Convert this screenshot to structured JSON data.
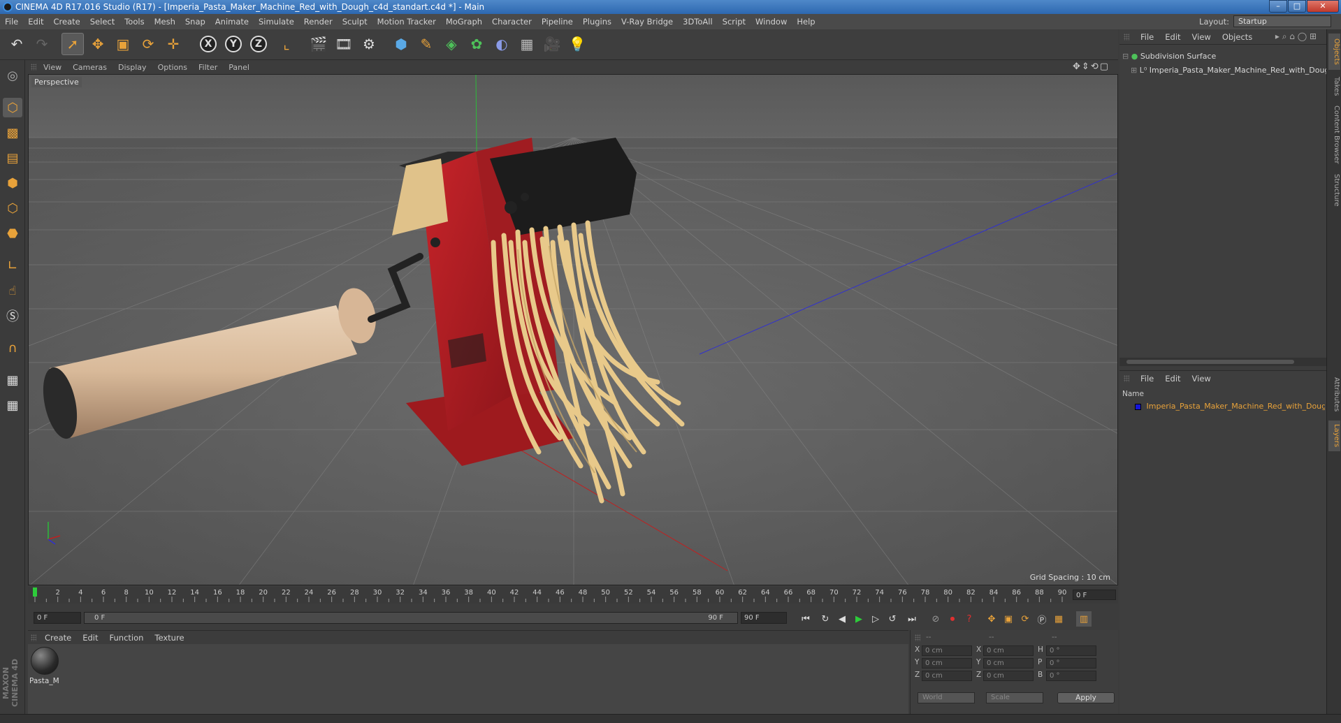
{
  "window": {
    "title": "CINEMA 4D R17.016 Studio (R17) - [Imperia_Pasta_Maker_Machine_Red_with_Dough_c4d_standart.c4d *] - Main",
    "minimize": "–",
    "maximize": "□",
    "close": "✕"
  },
  "menubar": {
    "items": [
      "File",
      "Edit",
      "Create",
      "Select",
      "Tools",
      "Mesh",
      "Snap",
      "Animate",
      "Simulate",
      "Render",
      "Sculpt",
      "Motion Tracker",
      "MoGraph",
      "Character",
      "Pipeline",
      "Plugins",
      "V-Ray Bridge",
      "3DToAll",
      "Script",
      "Window",
      "Help"
    ],
    "layout_label": "Layout:",
    "layout_value": "Startup"
  },
  "toolbar": {
    "axis_x": "X",
    "axis_y": "Y",
    "axis_z": "Z"
  },
  "viewport": {
    "menu": [
      "View",
      "Cameras",
      "Display",
      "Options",
      "Filter",
      "Panel"
    ],
    "camera_label": "Perspective",
    "grid_spacing": "Grid Spacing : 10 cm",
    "nav_icons": "✥⇕⟲▢"
  },
  "timeline": {
    "ticks": [
      "0",
      "2",
      "4",
      "6",
      "8",
      "10",
      "12",
      "14",
      "16",
      "18",
      "20",
      "22",
      "24",
      "26",
      "28",
      "30",
      "32",
      "34",
      "36",
      "38",
      "40",
      "42",
      "44",
      "46",
      "48",
      "50",
      "52",
      "54",
      "56",
      "58",
      "60",
      "62",
      "64",
      "66",
      "68",
      "70",
      "72",
      "74",
      "76",
      "78",
      "80",
      "82",
      "84",
      "86",
      "88",
      "90"
    ],
    "current_frame_right": "0 F",
    "start_frame": "0 F",
    "range_start": "0 F",
    "range_end": "90 F",
    "end_frame": "90 F"
  },
  "material_manager": {
    "menu": [
      "Create",
      "Edit",
      "Function",
      "Texture"
    ],
    "materials": [
      {
        "name": "Pasta_M"
      }
    ]
  },
  "coordinates": {
    "header": [
      "--",
      "--",
      "--"
    ],
    "rows": [
      {
        "a": "X",
        "a_val": "0 cm",
        "b": "X",
        "b_val": "0 cm",
        "c": "H",
        "c_val": "0 °"
      },
      {
        "a": "Y",
        "a_val": "0 cm",
        "b": "Y",
        "b_val": "0 cm",
        "c": "P",
        "c_val": "0 °"
      },
      {
        "a": "Z",
        "a_val": "0 cm",
        "b": "Z",
        "b_val": "0 cm",
        "c": "B",
        "c_val": "0 °"
      }
    ],
    "space": "World",
    "mode": "Scale",
    "apply": "Apply"
  },
  "object_manager": {
    "menu": [
      "File",
      "Edit",
      "View",
      "Objects"
    ],
    "objects": [
      {
        "name": "Subdivision Surface"
      },
      {
        "name": "Imperia_Pasta_Maker_Machine_Red_with_Dough"
      }
    ]
  },
  "layer_manager": {
    "menu": [
      "File",
      "Edit",
      "View"
    ],
    "column_name": "Name",
    "layers": [
      {
        "name": "Imperia_Pasta_Maker_Machine_Red_with_Dough",
        "color": "#1515d8"
      }
    ]
  },
  "right_tabs": [
    "Objects",
    "Takes",
    "Content Browser",
    "Structure",
    "Attributes",
    "Layers"
  ],
  "branding": "MAXON CINEMA 4D",
  "colors": {
    "accent": "#e8a23a",
    "machine_red": "#b51f24",
    "pasta": "#e8c98a"
  }
}
